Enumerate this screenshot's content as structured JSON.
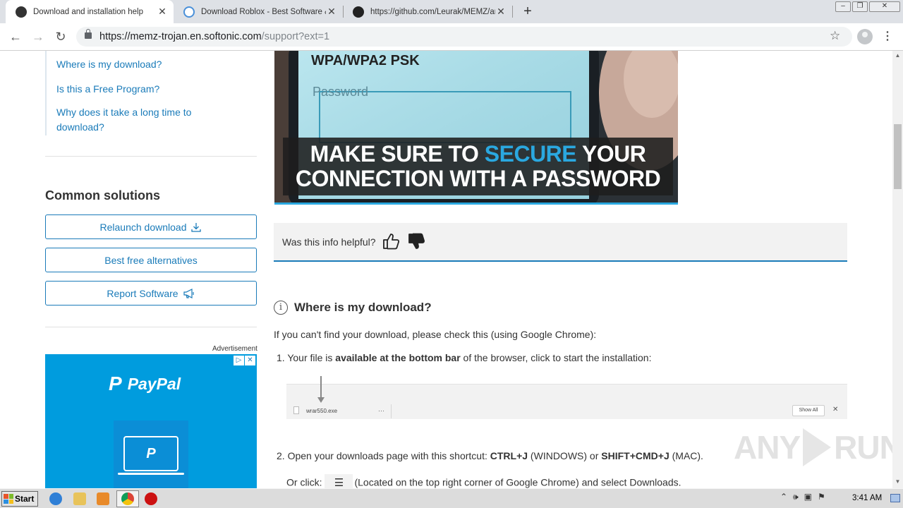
{
  "browser": {
    "tabs": [
      {
        "title": "Download and installation help",
        "active": true
      },
      {
        "title": "Download Roblox - Best Software &",
        "active": false
      },
      {
        "title": "https://github.com/Leurak/MEMZ/ar",
        "active": false
      }
    ],
    "new_tab_label": "+",
    "url_host": "https://memz-trojan.en.softonic.com",
    "url_path": "/support?ext=1",
    "window_buttons": {
      "minimize": "‒",
      "restore": "❐",
      "close": "✕"
    }
  },
  "sidebar": {
    "toc_links": [
      "Where is my download?",
      "Is this a Free Program?",
      "Why does it take a long time to download?"
    ],
    "common_solutions_title": "Common solutions",
    "buttons": [
      {
        "label": "Relaunch download",
        "icon": "download-icon"
      },
      {
        "label": "Best free alternatives",
        "icon": ""
      },
      {
        "label": "Report Software",
        "icon": "megaphone-icon"
      }
    ],
    "ad_label": "Advertisement",
    "ad_brand": "PayPal"
  },
  "video": {
    "screen_text_1": "WPA/WPA2 PSK",
    "screen_text_2": "Password",
    "caption_line1_pre": "MAKE SURE TO ",
    "caption_highlight": "SECURE",
    "caption_line1_post": " YOUR",
    "caption_line2": "CONNECTION WITH A PASSWORD"
  },
  "helpful": {
    "question": "Was this info helpful?"
  },
  "section": {
    "title": "Where is my download?",
    "intro": "If you can't find your download, please check this (using Google Chrome):",
    "step1_num": "1.",
    "step1_a": "Your file is ",
    "step1_b": "available at the bottom bar",
    "step1_c": " of the browser, click to start the installation:",
    "download_bar": {
      "filename": "wrar550.exe",
      "show_all": "Show All",
      "menu_glyph": "⋯",
      "close_glyph": "✕"
    },
    "step2_num": "2.",
    "step2_a": "Open your downloads page with this shortcut: ",
    "step2_b": "CTRL+J",
    "step2_c": " (WINDOWS) or ",
    "step2_d": "SHIFT+CMD+J",
    "step2_e": " (MAC).",
    "step2_or_click": "Or click: ",
    "step2_menu_glyph": "☰",
    "step2_rest": "(Located on the top right corner of Google Chrome) and select Downloads."
  },
  "watermark": {
    "left": "ANY",
    "right": "RUN"
  },
  "taskbar": {
    "start_label": "Start",
    "clock": "3:41 AM"
  },
  "colors": {
    "link": "#1a7bb9",
    "accent_caption": "#2aa8e0",
    "paypal_bg": "#009cde"
  }
}
